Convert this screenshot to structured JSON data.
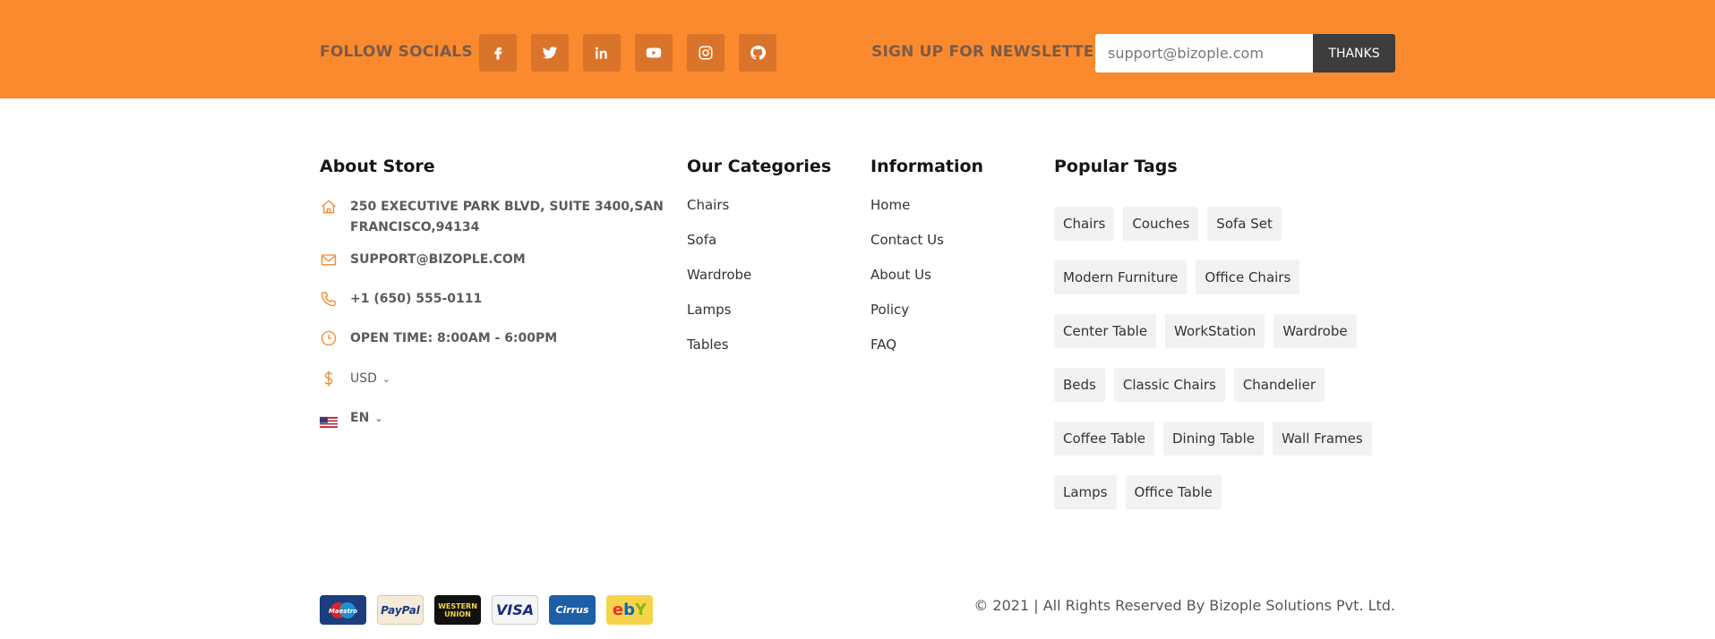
{
  "topbar": {
    "follow_label": "FOLLOW SOCIALS",
    "socials": [
      {
        "name": "facebook-icon"
      },
      {
        "name": "twitter-icon"
      },
      {
        "name": "linkedin-icon"
      },
      {
        "name": "youtube-icon"
      },
      {
        "name": "instagram-icon"
      },
      {
        "name": "github-icon"
      }
    ],
    "newsletter_label": "SIGN UP FOR NEWSLETTER",
    "newsletter_placeholder": "support@bizople.com",
    "newsletter_button": "THANKS",
    "colors": {
      "bar": "#fb8a2e",
      "social_button": "#d9742a",
      "submit_button": "#3d3d3d"
    }
  },
  "about": {
    "title": "About Store",
    "address_line1": "250 EXECUTIVE PARK BLVD, SUITE 3400,SAN",
    "address_line2": "FRANCISCO,94134",
    "email": "SUPPORT@BIZOPLE.COM",
    "phone": "+1 (650) 555-0111",
    "hours": "OPEN TIME: 8:00AM - 6:00PM",
    "currency": "USD",
    "language": "EN",
    "icon_color": "#f2892e"
  },
  "categories": {
    "title": "Our Categories",
    "items": [
      "Chairs",
      "Sofa",
      "Wardrobe",
      "Lamps",
      "Tables"
    ]
  },
  "information": {
    "title": "Information",
    "items": [
      "Home",
      "Contact Us",
      "About Us",
      "Policy",
      "FAQ"
    ]
  },
  "tags": {
    "title": "Popular Tags",
    "items": [
      "Chairs",
      "Couches",
      "Sofa Set",
      "Modern Furniture",
      "Office Chairs",
      "Center Table",
      "WorkStation",
      "Wardrobe",
      "Beds",
      "Classic Chairs",
      "Chandelier",
      "Coffee Table",
      "Dining Table",
      "Wall Frames",
      "Lamps",
      "Office Table"
    ]
  },
  "payments": {
    "maestro": "Maestro",
    "paypal": "PayPal",
    "western_union": "WESTERN UNION",
    "visa": "VISA",
    "cirrus": "Cirrus",
    "ebay": "ebY"
  },
  "copyright": "© 2021 | All Rights Reserved By Bizople Solutions Pvt. Ltd."
}
